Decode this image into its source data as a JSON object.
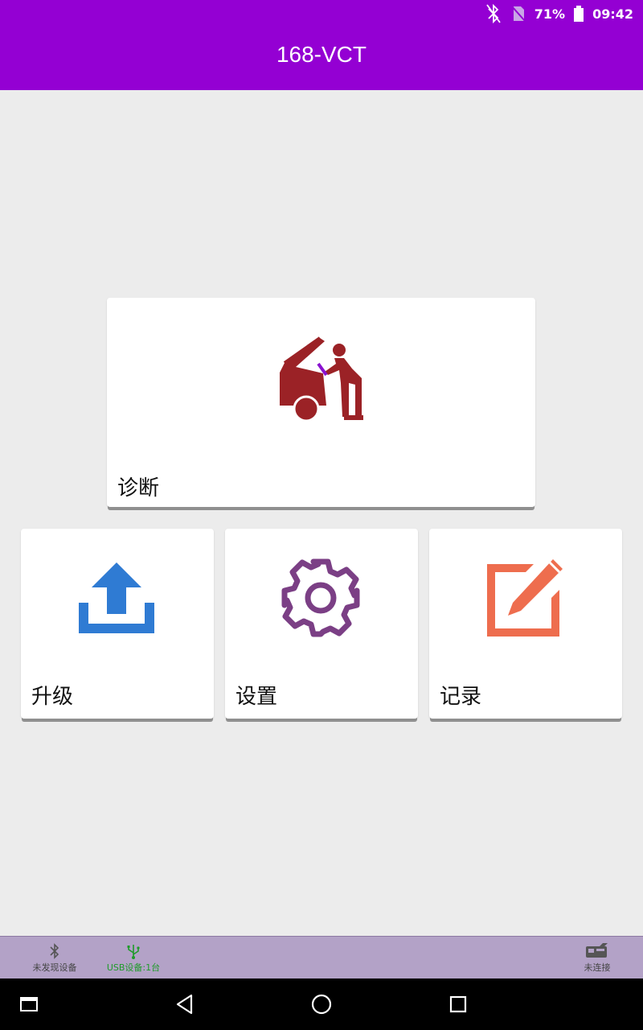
{
  "status_bar": {
    "battery_percent": "71%",
    "time": "09:42",
    "icons": [
      "bluetooth-off-icon",
      "no-sim-icon",
      "battery-icon"
    ]
  },
  "app_bar": {
    "title": "168-VCT"
  },
  "cards": {
    "diagnosis": {
      "label": "诊断",
      "icon": "mechanic-car-icon",
      "color": "#9b2226"
    },
    "upgrade": {
      "label": "升级",
      "icon": "upload-icon",
      "color": "#2f7bd3"
    },
    "settings": {
      "label": "设置",
      "icon": "gear-icon",
      "color": "#7b3f85"
    },
    "records": {
      "label": "记录",
      "icon": "edit-icon",
      "color": "#ee6d4e"
    }
  },
  "device_bar": {
    "bluetooth": {
      "label": "未发现设备",
      "icon": "bluetooth-icon",
      "color": "#555555"
    },
    "usb": {
      "label": "USB设备:1台",
      "icon": "usb-icon",
      "color": "#1f9b2a"
    },
    "connection": {
      "label": "未连接",
      "icon": "vci-device-icon",
      "color": "#444444"
    }
  },
  "nav_bar": {
    "buttons": [
      "recent-apps-icon",
      "back-icon",
      "home-icon",
      "overview-icon"
    ]
  }
}
